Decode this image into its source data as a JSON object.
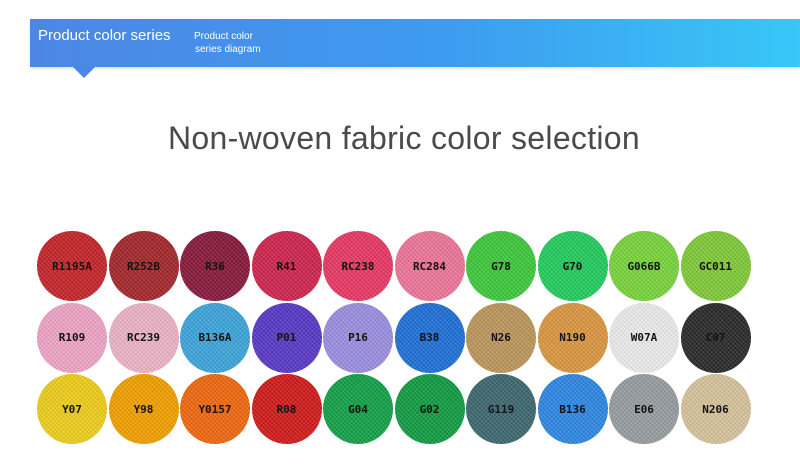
{
  "banner": {
    "title": "Product color series",
    "subtitle_line1": "Product color",
    "subtitle_line2": "series diagram"
  },
  "heading": "Non-woven fabric color selection",
  "swatches": [
    {
      "code": "R1195A",
      "color": "#c9262b"
    },
    {
      "code": "R252B",
      "color": "#a8282c"
    },
    {
      "code": "R36",
      "color": "#8b1a3d"
    },
    {
      "code": "R41",
      "color": "#d4264f"
    },
    {
      "code": "RC238",
      "color": "#ee3a66"
    },
    {
      "code": "RC284",
      "color": "#f2799c"
    },
    {
      "code": "G78",
      "color": "#3fce3d"
    },
    {
      "code": "G70",
      "color": "#23d160"
    },
    {
      "code": "G066B",
      "color": "#7bd93f"
    },
    {
      "code": "GC011",
      "color": "#82cf3a"
    },
    {
      "code": "R109",
      "color": "#f4a8cb"
    },
    {
      "code": "RC239",
      "color": "#f2b8cb"
    },
    {
      "code": "B136A",
      "color": "#3ea9e0"
    },
    {
      "code": "P01",
      "color": "#5a3acb"
    },
    {
      "code": "P16",
      "color": "#9f92e6"
    },
    {
      "code": "B38",
      "color": "#1f73dc"
    },
    {
      "code": "N26",
      "color": "#c19a5e"
    },
    {
      "code": "N190",
      "color": "#e09a42"
    },
    {
      "code": "W07A",
      "color": "#f1f1f1"
    },
    {
      "code": "C07",
      "color": "#2b2b2b"
    },
    {
      "code": "Y07",
      "color": "#f3d31b"
    },
    {
      "code": "Y98",
      "color": "#f7a400"
    },
    {
      "code": "Y0157",
      "color": "#f56a10"
    },
    {
      "code": "R08",
      "color": "#d61b1b"
    },
    {
      "code": "G04",
      "color": "#13a54a"
    },
    {
      "code": "G02",
      "color": "#12a044"
    },
    {
      "code": "G119",
      "color": "#3e6a72"
    },
    {
      "code": "B136",
      "color": "#2f8bea"
    },
    {
      "code": "E06",
      "color": "#9aa1a4"
    },
    {
      "code": "N206",
      "color": "#dcc7a0"
    }
  ]
}
